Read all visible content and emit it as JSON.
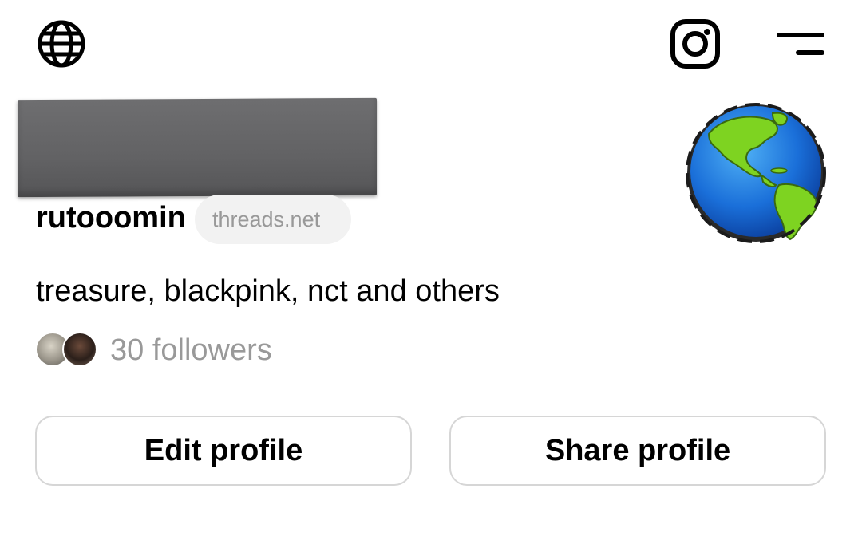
{
  "header": {
    "icons": [
      "globe-icon",
      "instagram-icon",
      "menu-icon"
    ]
  },
  "profile": {
    "username": "rutooomin",
    "domain_badge": "threads.net",
    "bio": "treasure, blackpink, nct and others",
    "followers_text": "30 followers",
    "avatar": "earth-globe-image"
  },
  "actions": {
    "edit_label": "Edit profile",
    "share_label": "Share profile"
  },
  "colors": {
    "text": "#000000",
    "muted_text": "#999999",
    "pill_bg": "#f2f2f2",
    "button_border": "#d6d6d6",
    "redaction": "#646466"
  }
}
